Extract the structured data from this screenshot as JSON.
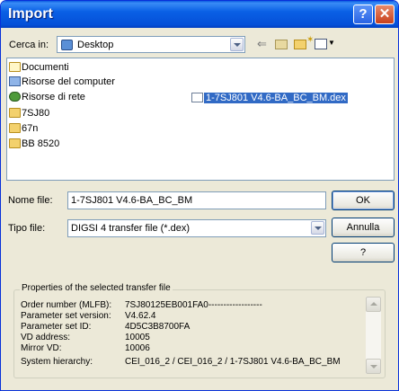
{
  "window": {
    "title": "Import",
    "help_glyph": "?",
    "close_glyph": "✕"
  },
  "lookin": {
    "label": "Cerca in:",
    "value": "Desktop"
  },
  "file_list": {
    "items": [
      {
        "label": "Documenti",
        "icon": "folder-icon"
      },
      {
        "label": "Risorse del computer",
        "icon": "computer-icon"
      },
      {
        "label": "Risorse di rete",
        "icon": "network-icon"
      },
      {
        "label": "7SJ80",
        "icon": "folder-icon"
      },
      {
        "label": "67n",
        "icon": "folder-icon"
      },
      {
        "label": "BB 8520",
        "icon": "folder-icon"
      }
    ],
    "selected_file": "1-7SJ801 V4.6-BA_BC_BM.dex"
  },
  "filename": {
    "label": "Nome file:",
    "value": "1-7SJ801 V4.6-BA_BC_BM"
  },
  "filetype": {
    "label": "Tipo file:",
    "value": "DIGSI 4 transfer file (*.dex)"
  },
  "buttons": {
    "ok": "OK",
    "cancel": "Annulla",
    "help": "?"
  },
  "properties": {
    "title": "Properties of the selected transfer file",
    "rows": [
      {
        "key": "Order number (MLFB):",
        "value": "7SJ80125EB001FA0------------------"
      },
      {
        "key": "Parameter set version:",
        "value": "V4.62.4"
      },
      {
        "key": "Parameter set ID:",
        "value": "4D5C3B8700FA"
      },
      {
        "key": "VD address:",
        "value": "10005"
      },
      {
        "key": "Mirror VD:",
        "value": "10006"
      },
      {
        "key": "System hierarchy:",
        "value": "CEI_016_2 / CEI_016_2 / 1-7SJ801 V4.6-BA_BC_BM"
      }
    ]
  },
  "colors": {
    "titlebar": "#0a5be0",
    "selection": "#316ac5",
    "dialog_bg": "#ece9d8"
  }
}
